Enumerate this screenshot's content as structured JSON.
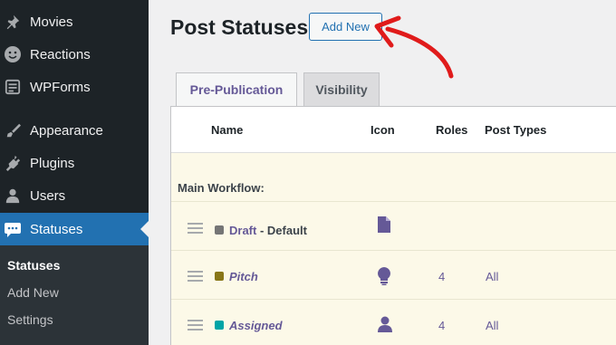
{
  "sidebar": {
    "items": [
      {
        "label": "Movies",
        "icon": "pin-icon"
      },
      {
        "label": "Reactions",
        "icon": "smiley-icon"
      },
      {
        "label": "WPForms",
        "icon": "forms-icon"
      },
      {
        "label": "Appearance",
        "icon": "paintbrush-icon"
      },
      {
        "label": "Plugins",
        "icon": "plug-icon"
      },
      {
        "label": "Users",
        "icon": "user-icon"
      },
      {
        "label": "Statuses",
        "icon": "speech-bubble-icon"
      }
    ],
    "submenu": [
      "Statuses",
      "Add New",
      "Settings"
    ]
  },
  "header": {
    "title": "Post Statuses",
    "add_new_label": "Add New"
  },
  "tabs": [
    "Pre-Publication",
    "Visibility"
  ],
  "table": {
    "columns": [
      "Name",
      "Icon",
      "Roles",
      "Post Types"
    ],
    "group": "Main Workflow:",
    "rows": [
      {
        "name": "Draft",
        "suffix": " - Default",
        "color": "#757575",
        "icon": "document-icon",
        "roles": "",
        "types": ""
      },
      {
        "name": "Pitch",
        "suffix": "",
        "color": "#887618",
        "icon": "lightbulb-icon",
        "roles": "4",
        "types": "All"
      },
      {
        "name": "Assigned",
        "suffix": "",
        "color": "#00a4a6",
        "icon": "person-icon",
        "roles": "4",
        "types": "All"
      }
    ]
  },
  "colors": {
    "accent": "#2271b1",
    "status_text": "#655997",
    "annotation_arrow": "#e01b1b"
  }
}
